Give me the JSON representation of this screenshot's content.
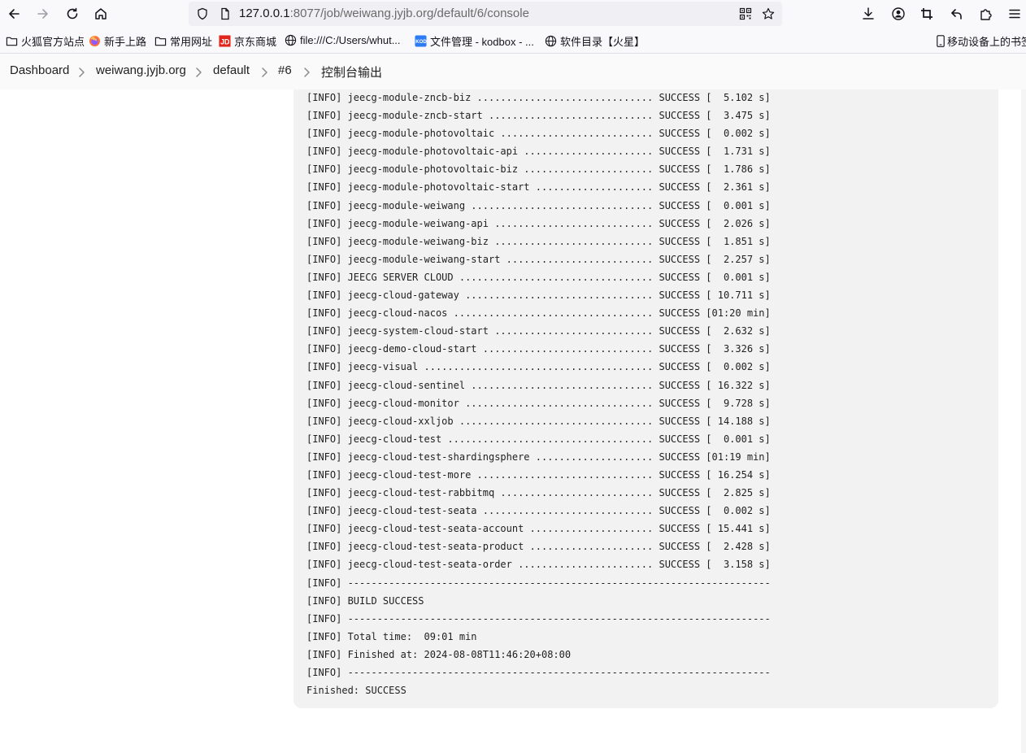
{
  "browser": {
    "url_host": "127.0.0.1",
    "url_rest": ":8077/job/weiwang.jyjb.org/default/6/console",
    "bookmarks": [
      {
        "label": "火狐官方站点",
        "icon": "folder-icon"
      },
      {
        "label": "新手上路",
        "icon": "firefox-icon"
      },
      {
        "label": "常用网址",
        "icon": "folder-icon"
      },
      {
        "label": "京东商城",
        "icon": "jd-icon"
      },
      {
        "label": "file:///C:/Users/whut...",
        "icon": "globe-icon"
      },
      {
        "label": "文件管理 - kodbox - ...",
        "icon": "kodbox-icon"
      },
      {
        "label": "软件目录【火星】",
        "icon": "globe-icon"
      }
    ],
    "mobile_bookmarks": "移动设备上的书签"
  },
  "breadcrumb": [
    {
      "label": "Dashboard"
    },
    {
      "label": "weiwang.jyjb.org"
    },
    {
      "label": "default"
    },
    {
      "label": "#6"
    },
    {
      "label": "控制台输出"
    }
  ],
  "console": {
    "lines": [
      "[INFO] jeecg-module-zncb-biz .............................. SUCCESS [  5.102 s]",
      "[INFO] jeecg-module-zncb-start ............................ SUCCESS [  3.475 s]",
      "[INFO] jeecg-module-photovoltaic .......................... SUCCESS [  0.002 s]",
      "[INFO] jeecg-module-photovoltaic-api ...................... SUCCESS [  1.731 s]",
      "[INFO] jeecg-module-photovoltaic-biz ...................... SUCCESS [  1.786 s]",
      "[INFO] jeecg-module-photovoltaic-start .................... SUCCESS [  2.361 s]",
      "[INFO] jeecg-module-weiwang ............................... SUCCESS [  0.001 s]",
      "[INFO] jeecg-module-weiwang-api ........................... SUCCESS [  2.026 s]",
      "[INFO] jeecg-module-weiwang-biz ........................... SUCCESS [  1.851 s]",
      "[INFO] jeecg-module-weiwang-start ......................... SUCCESS [  2.257 s]",
      "[INFO] JEECG SERVER CLOUD ................................. SUCCESS [  0.001 s]",
      "[INFO] jeecg-cloud-gateway ................................ SUCCESS [ 10.711 s]",
      "[INFO] jeecg-cloud-nacos .................................. SUCCESS [01:20 min]",
      "[INFO] jeecg-system-cloud-start ........................... SUCCESS [  2.632 s]",
      "[INFO] jeecg-demo-cloud-start ............................. SUCCESS [  3.326 s]",
      "[INFO] jeecg-visual ....................................... SUCCESS [  0.002 s]",
      "[INFO] jeecg-cloud-sentinel ............................... SUCCESS [ 16.322 s]",
      "[INFO] jeecg-cloud-monitor ................................ SUCCESS [  9.728 s]",
      "[INFO] jeecg-cloud-xxljob ................................. SUCCESS [ 14.188 s]",
      "[INFO] jeecg-cloud-test ................................... SUCCESS [  0.001 s]",
      "[INFO] jeecg-cloud-test-shardingsphere .................... SUCCESS [01:19 min]",
      "[INFO] jeecg-cloud-test-more .............................. SUCCESS [ 16.254 s]",
      "[INFO] jeecg-cloud-test-rabbitmq .......................... SUCCESS [  2.825 s]",
      "[INFO] jeecg-cloud-test-seata ............................. SUCCESS [  0.002 s]",
      "[INFO] jeecg-cloud-test-seata-account ..................... SUCCESS [ 15.441 s]",
      "[INFO] jeecg-cloud-test-seata-product ..................... SUCCESS [  2.428 s]",
      "[INFO] jeecg-cloud-test-seata-order ....................... SUCCESS [  3.158 s]",
      "[INFO] ------------------------------------------------------------------------",
      "[INFO] BUILD SUCCESS",
      "[INFO] ------------------------------------------------------------------------",
      "[INFO] Total time:  09:01 min",
      "[INFO] Finished at: 2024-08-08T11:46:20+08:00",
      "[INFO] ------------------------------------------------------------------------",
      "Finished: SUCCESS"
    ]
  }
}
